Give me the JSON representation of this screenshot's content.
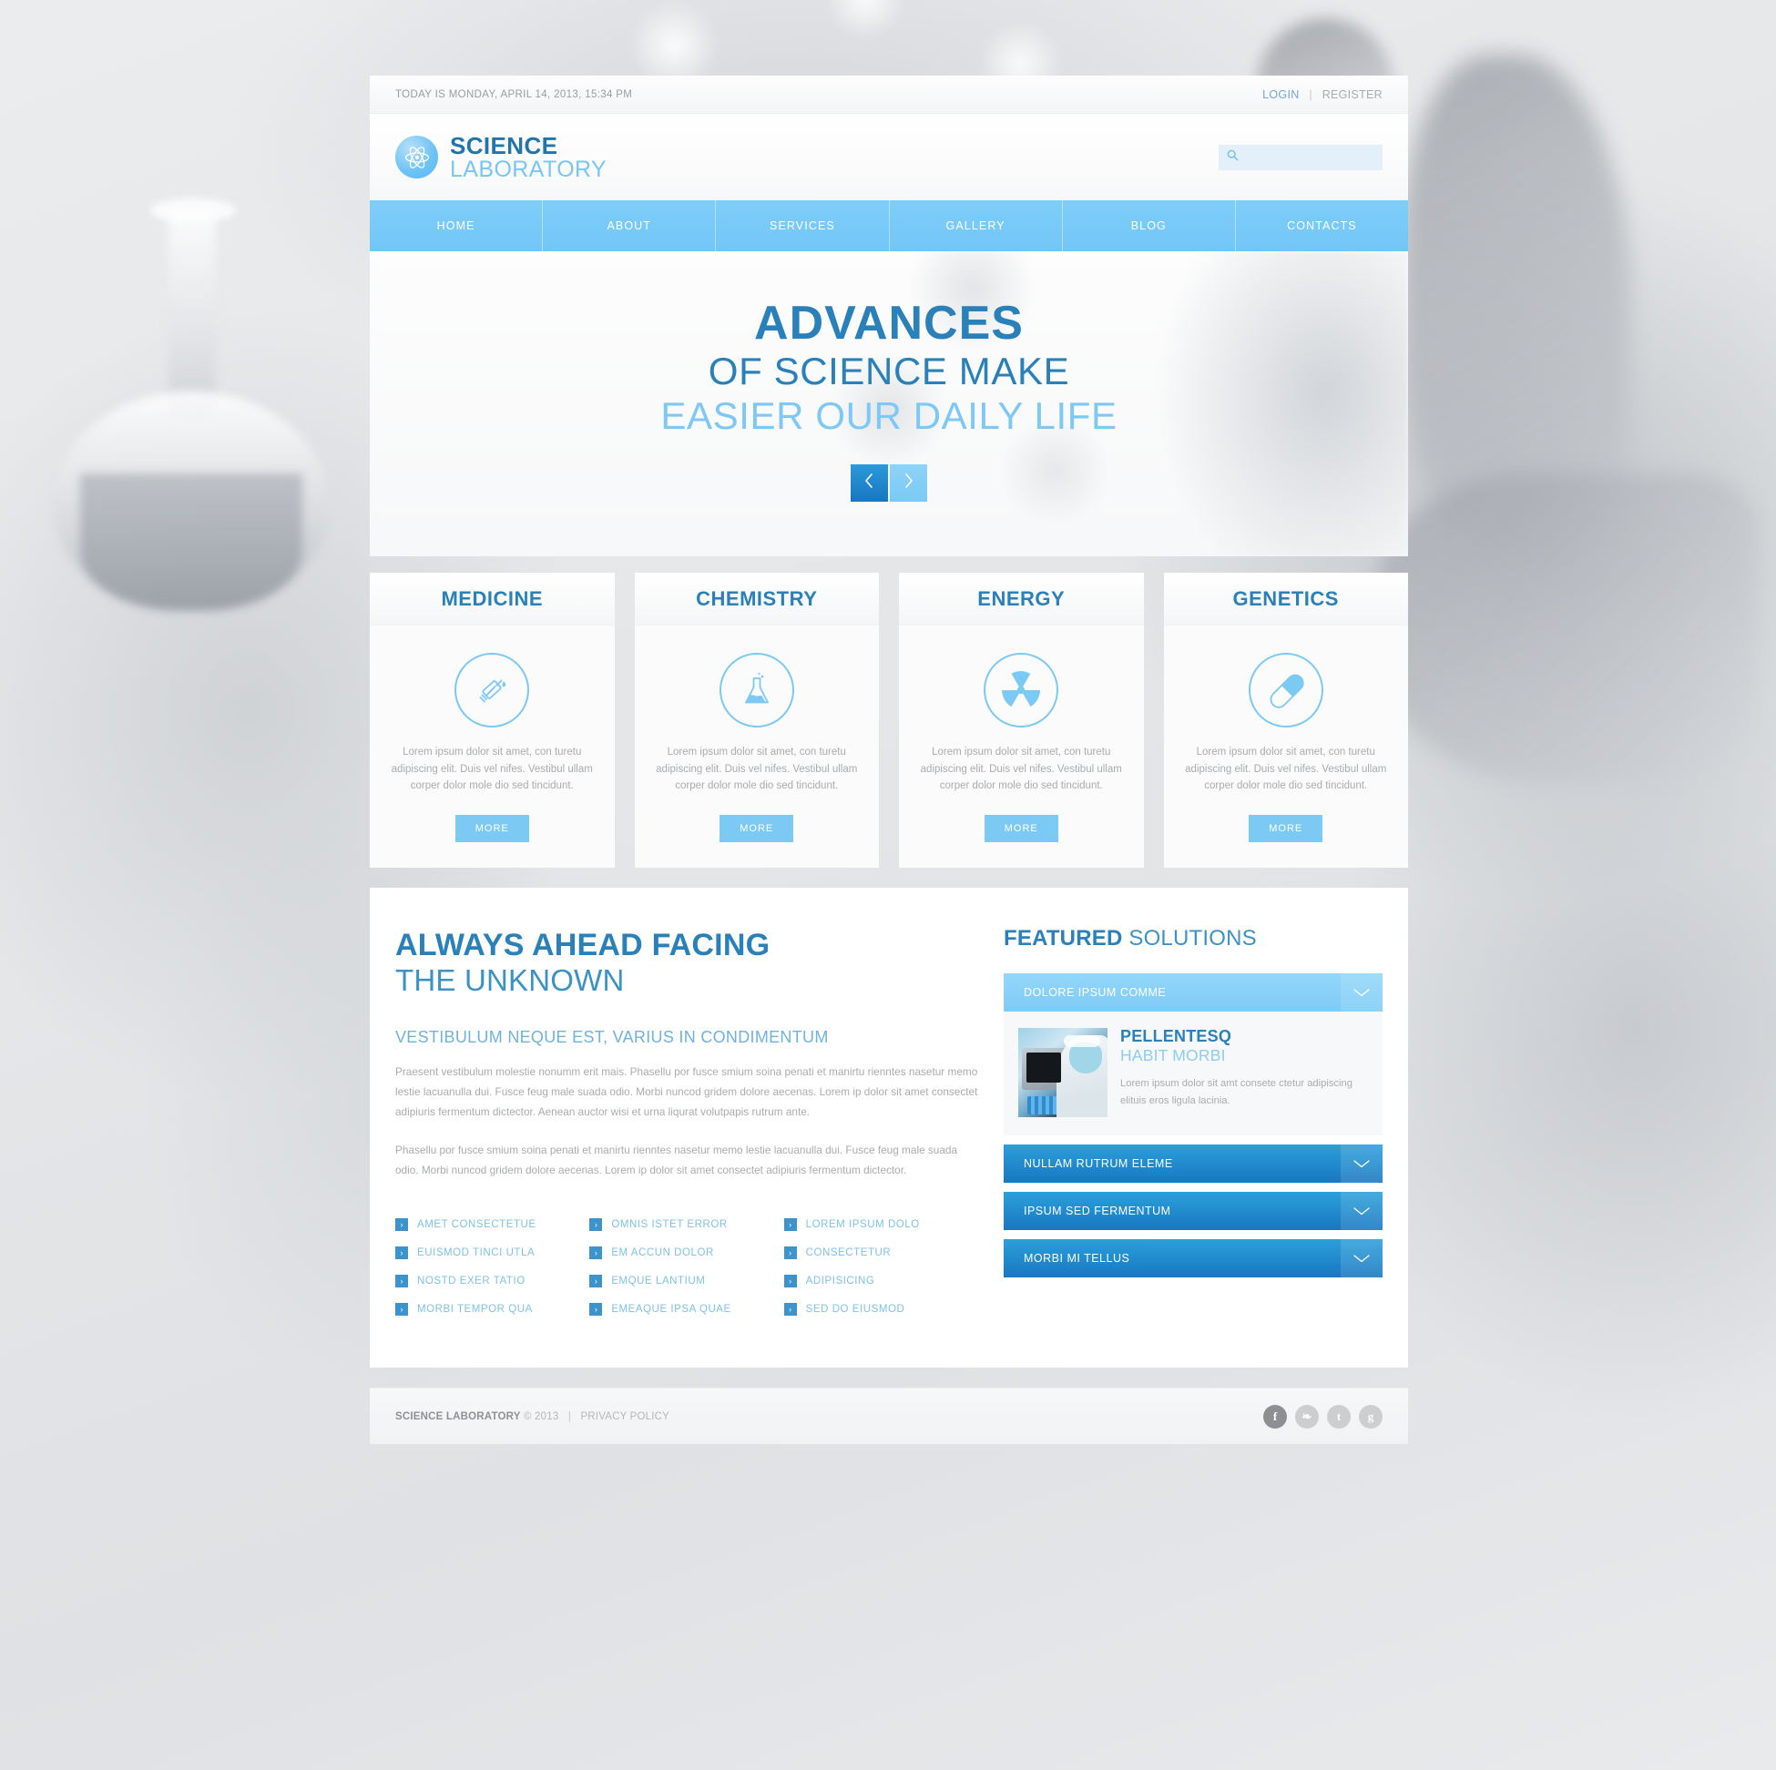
{
  "topbar": {
    "today": "TODAY IS MONDAY, APRIL 14, 2013, 15:34 PM",
    "login": "LOGIN",
    "separator": "|",
    "register": "REGISTER"
  },
  "header": {
    "logo_primary": "SCIENCE",
    "logo_secondary": "LABORATORY",
    "logo_icon": "atom-icon",
    "search_placeholder": "",
    "search_value": "",
    "search_icon": "search-icon"
  },
  "nav": {
    "items": [
      {
        "label": "HOME"
      },
      {
        "label": "ABOUT"
      },
      {
        "label": "SERVICES"
      },
      {
        "label": "GALLERY"
      },
      {
        "label": "BLOG"
      },
      {
        "label": "CONTACTS"
      }
    ]
  },
  "hero": {
    "line1": "ADVANCES",
    "line2": "OF SCIENCE MAKE",
    "line3": "EASIER OUR DAILY LIFE",
    "prev_icon": "chevron-left-icon",
    "next_icon": "chevron-right-icon"
  },
  "cards": [
    {
      "title": "MEDICINE",
      "icon": "syringe-icon",
      "text": "Lorem ipsum dolor sit amet, con turetu adipiscing elit. Duis vel nifes. Vestibul ullam corper dolor mole dio sed tincidunt.",
      "more": "MORE"
    },
    {
      "title": "CHEMISTRY",
      "icon": "flask-icon",
      "text": "Lorem ipsum dolor sit amet, con turetu adipiscing elit. Duis vel nifes. Vestibul ullam corper dolor mole dio sed tincidunt.",
      "more": "MORE"
    },
    {
      "title": "ENERGY",
      "icon": "radiation-icon",
      "text": "Lorem ipsum dolor sit amet, con turetu adipiscing elit. Duis vel nifes. Vestibul ullam corper dolor mole dio sed tincidunt.",
      "more": "MORE"
    },
    {
      "title": "GENETICS",
      "icon": "pill-icon",
      "text": "Lorem ipsum dolor sit amet, con turetu adipiscing elit. Duis vel nifes. Vestibul ullam corper dolor mole dio sed tincidunt.",
      "more": "MORE"
    }
  ],
  "main": {
    "heading_bold": "ALWAYS AHEAD FACING",
    "heading_thin": "THE UNKNOWN",
    "subheading": "VESTIBULUM NEQUE EST, VARIUS IN CONDIMENTUM",
    "paragraph1": "Praesent vestibulum molestie nonumm erit mais. Phasellu por fusce smium soina penati et manirtu rienntes nasetur memo lestie lacuanulla dui. Fusce feug male suada odio. Morbi nuncod gridem dolore aecenas. Lorem ip dolor sit amet consectet adipiuris fermentum dictector. Aenean auctor wisi et urna liqurat volutpapis rutrum ante.",
    "paragraph2": "Phasellu por fusce smium soina penati et manirtu rienntes nasetur memo lestie lacuanulla dui. Fusce feug male suada odio. Morbi nuncod gridem dolore aecenas. Lorem ip dolor sit amet consectet adipiuris fermentum dictector.",
    "link_columns": [
      [
        {
          "label": "AMET CONSECTETUE"
        },
        {
          "label": "EUISMOD TINCI UTLA"
        },
        {
          "label": "NOSTD EXER TATIO"
        },
        {
          "label": "MORBI TEMPOR QUA"
        }
      ],
      [
        {
          "label": "OMNIS ISTET ERROR"
        },
        {
          "label": "EM ACCUN DOLOR"
        },
        {
          "label": "EMQUE LANTIUM"
        },
        {
          "label": "EMEAQUE IPSA QUAE"
        }
      ],
      [
        {
          "label": "LOREM IPSUM DOLO"
        },
        {
          "label": "CONSECTETUR"
        },
        {
          "label": "ADIPISICING"
        },
        {
          "label": "SED DO EIUSMOD"
        }
      ]
    ]
  },
  "featured": {
    "title_bold": "FEATURED",
    "title_thin": "SOLUTIONS",
    "chevron_icon": "chevron-down-icon",
    "items": [
      {
        "label": "DOLORE IPSUM COMME",
        "open": true,
        "panel": {
          "thumb": "scientist-photo",
          "heading_bold": "PELLENTESQ",
          "heading_thin": "HABIT MORBI",
          "text": "Lorem ipsum dolor sit amt consete ctetur adipiscing elituis eros ligula lacinia."
        }
      },
      {
        "label": "NULLAM RUTRUM ELEME",
        "open": false
      },
      {
        "label": "IPSUM SED FERMENTUM",
        "open": false
      },
      {
        "label": "MORBI MI TELLUS",
        "open": false
      }
    ]
  },
  "footer": {
    "brand": "SCIENCE LABORATORY",
    "copyright": "© 2013",
    "divider": "|",
    "privacy": "PRIVACY POLICY",
    "socials": [
      {
        "name": "facebook-icon",
        "glyph": "f"
      },
      {
        "name": "rss-icon",
        "glyph": "❧"
      },
      {
        "name": "twitter-icon",
        "glyph": "t"
      },
      {
        "name": "google-plus-icon",
        "glyph": "g"
      }
    ]
  },
  "colors": {
    "accent_light": "#7cc9f4",
    "accent_dark": "#2a80b8",
    "accent_mid": "#3d94cd",
    "text_muted": "#a9abad"
  }
}
